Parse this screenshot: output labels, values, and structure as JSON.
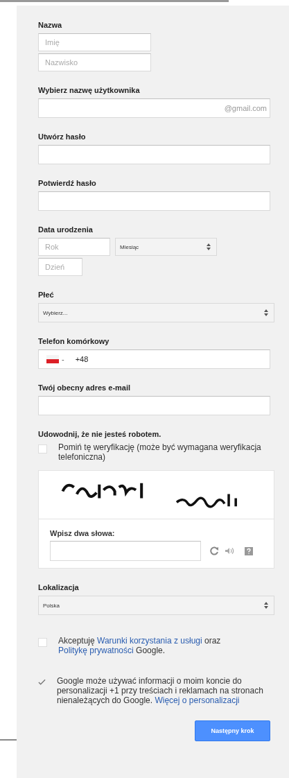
{
  "name": {
    "label": "Nazwa",
    "first": {
      "placeholder": "Imię"
    },
    "last": {
      "placeholder": "Nazwisko"
    }
  },
  "fields": [
    {
      "kind": "suffix",
      "label": "Wybierz nazwę użytkownika",
      "suffix": "@gmail.com"
    },
    {
      "kind": "text",
      "label": "Utwórz hasło"
    },
    {
      "kind": "text",
      "label": "Potwierdź hasło"
    }
  ],
  "birth": {
    "label": "Data urodzenia",
    "year": {
      "placeholder": "Rok"
    },
    "month": {
      "value": "Miesiąc"
    },
    "day": {
      "placeholder": "Dzień"
    }
  },
  "gender": {
    "label": "Płeć",
    "value": "Wybierz..."
  },
  "phone": {
    "label": "Telefon komórkowy",
    "country_caret": "-",
    "value": "+48"
  },
  "email": {
    "label": "Twój obecny adres e-mail"
  },
  "robot": {
    "label": "Udowodnij, że nie jesteś robotem.",
    "skip": {
      "checked": false,
      "text": "Pomiń tę weryfikację (może być wymagana weryfikacja telefoniczna)"
    },
    "captcha": {
      "kind": "picture",
      "prompt": "Wpisz dwa słowa:"
    }
  },
  "location": {
    "label": "Lokalizacja",
    "value": "Polska"
  },
  "agreements": [
    {
      "checked": false,
      "parts": [
        {
          "text": "Akceptuję ",
          "link": false
        },
        {
          "text": "Warunki korzystania z usługi",
          "link": true
        },
        {
          "text": " oraz ",
          "link": false
        },
        {
          "text": "Politykę prywatności",
          "link": true
        },
        {
          "text": " Google.",
          "link": false
        }
      ]
    },
    {
      "checked": true,
      "parts": [
        {
          "text": "Google może używać informacji o moim koncie do personalizacji +1 przy treściach i reklamach na stronach nienależących do Google. ",
          "link": false
        },
        {
          "text": "Więcej o personalizacji",
          "link": true
        }
      ]
    }
  ],
  "next_button": "Następny krok"
}
